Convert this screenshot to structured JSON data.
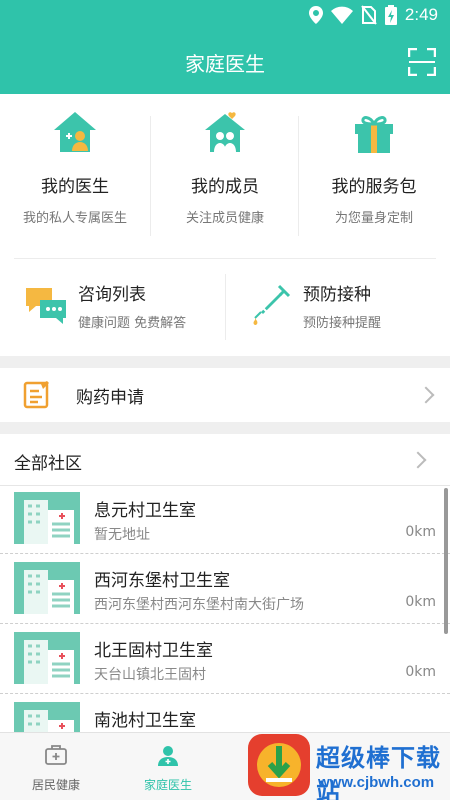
{
  "status_bar": {
    "time": "2:49"
  },
  "header": {
    "title": "家庭医生"
  },
  "features": [
    {
      "title": "我的医生",
      "subtitle": "我的私人专属医生"
    },
    {
      "title": "我的成员",
      "subtitle": "关注成员健康"
    },
    {
      "title": "我的服务包",
      "subtitle": "为您量身定制"
    }
  ],
  "quick": [
    {
      "title": "咨询列表",
      "subtitle": "健康问题 免费解答"
    },
    {
      "title": "预防接种",
      "subtitle": "预防接种提醒"
    }
  ],
  "purchase": {
    "label": "购药申请"
  },
  "community": {
    "header": "全部社区",
    "items": [
      {
        "name": "息元村卫生室",
        "address": "暂无地址",
        "distance": "0km"
      },
      {
        "name": "西河东堡村卫生室",
        "address": "西河东堡村西河东堡村南大街广场",
        "distance": "0km"
      },
      {
        "name": "北王固村卫生室",
        "address": "天台山镇北王固村",
        "distance": "0km"
      },
      {
        "name": "南池村卫生室",
        "address": "",
        "distance": ""
      }
    ]
  },
  "tabs": [
    {
      "label": "居民健康",
      "icon": "medical-kit-icon",
      "active": false
    },
    {
      "label": "家庭医生",
      "icon": "doctor-icon",
      "active": true
    }
  ],
  "watermark": {
    "title": "超级棒下载站",
    "url": "www.cjbwh.com"
  },
  "colors": {
    "primary": "#2fc3aa",
    "accent_orange": "#f0a030",
    "watermark_blue": "#1f6fd1"
  }
}
